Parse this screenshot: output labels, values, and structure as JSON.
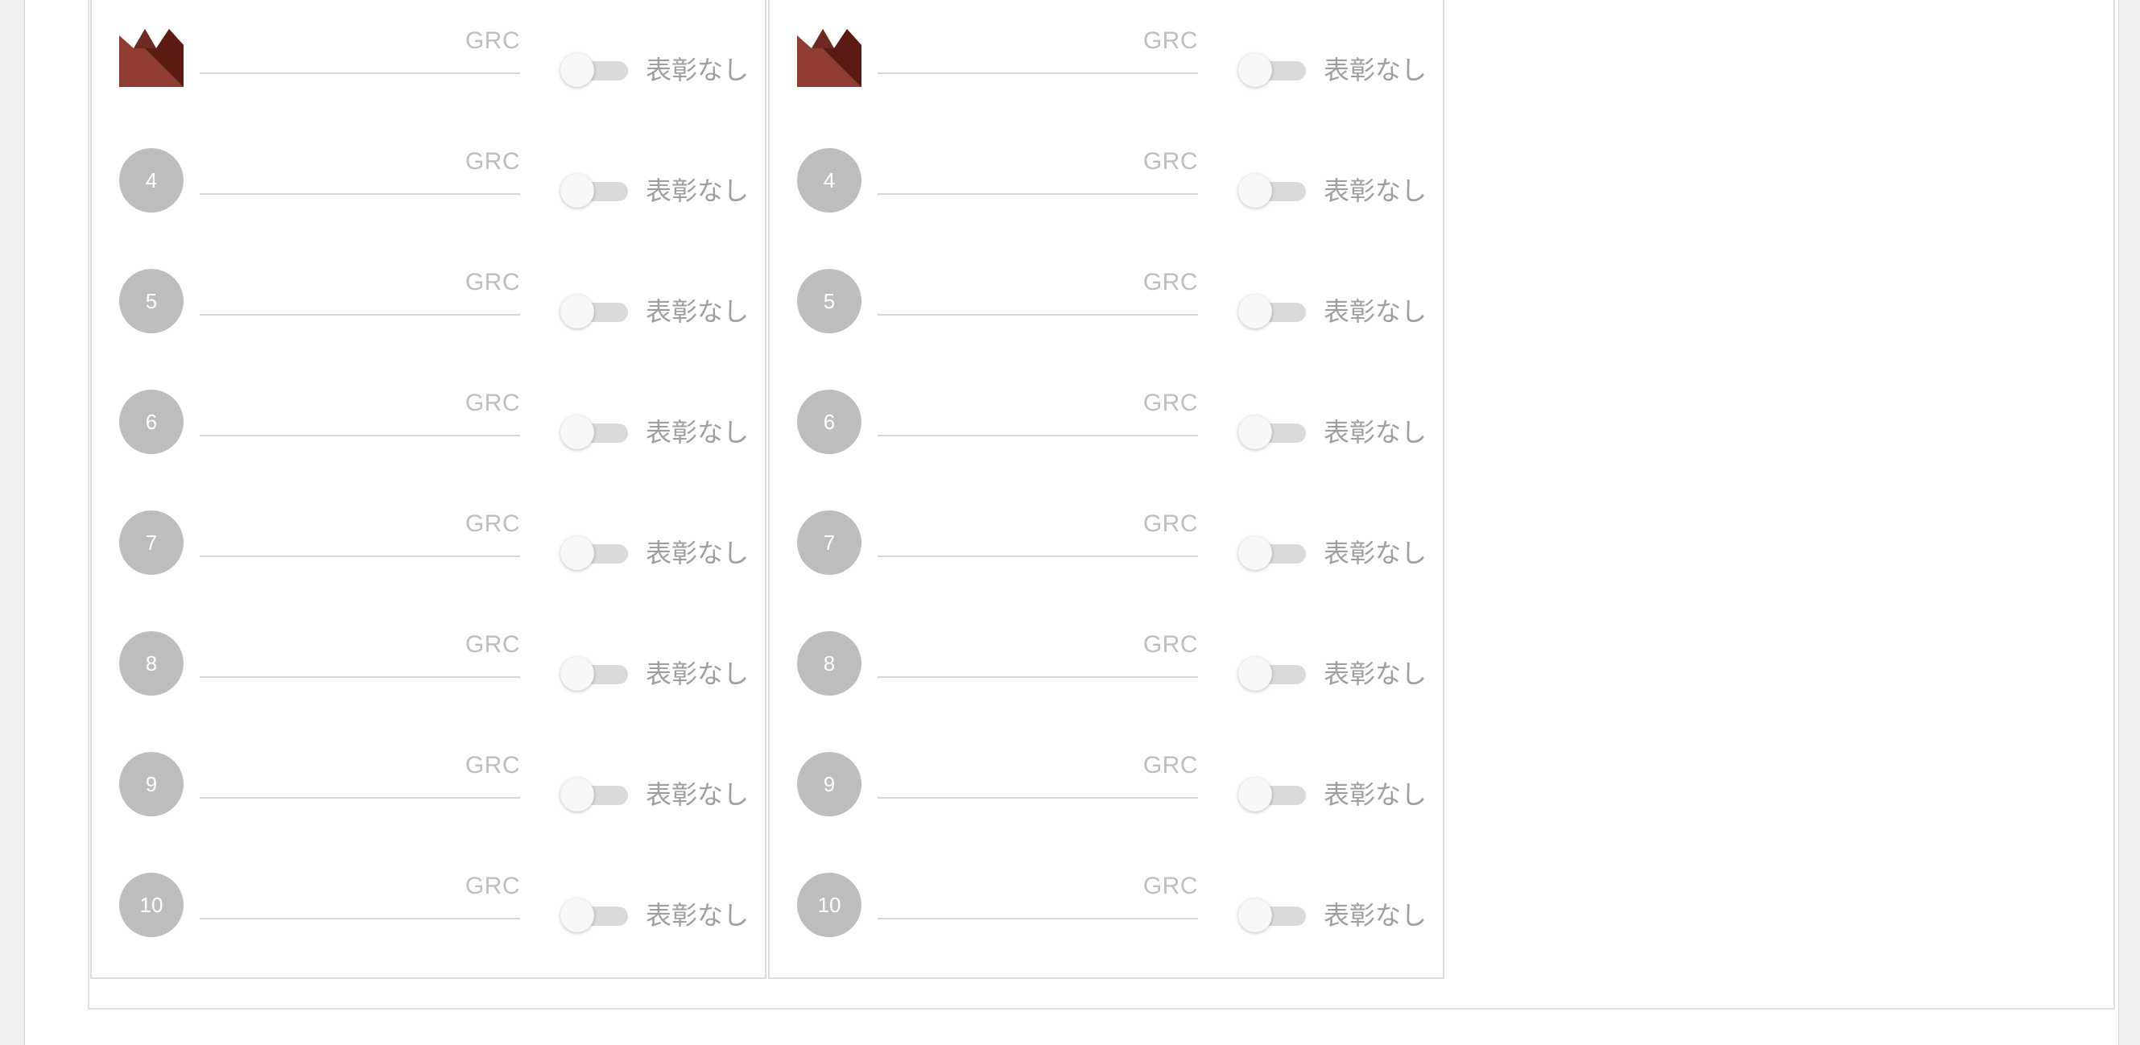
{
  "unit_label": "GRC",
  "award_toggle_label": "表彰なし",
  "colors": {
    "rank_badge": "#bdbdbd",
    "crown_dark": "#5c1a14",
    "crown_light": "#8f3d33"
  },
  "panels": [
    {
      "rows": [
        {
          "rank": "",
          "icon": "crown-icon",
          "value": "",
          "award": false
        },
        {
          "rank": "4",
          "value": "",
          "award": false
        },
        {
          "rank": "5",
          "value": "",
          "award": false
        },
        {
          "rank": "6",
          "value": "",
          "award": false
        },
        {
          "rank": "7",
          "value": "",
          "award": false
        },
        {
          "rank": "8",
          "value": "",
          "award": false
        },
        {
          "rank": "9",
          "value": "",
          "award": false
        },
        {
          "rank": "10",
          "value": "",
          "award": false
        }
      ]
    },
    {
      "rows": [
        {
          "rank": "",
          "icon": "crown-icon",
          "value": "",
          "award": false
        },
        {
          "rank": "4",
          "value": "",
          "award": false
        },
        {
          "rank": "5",
          "value": "",
          "award": false
        },
        {
          "rank": "6",
          "value": "",
          "award": false
        },
        {
          "rank": "7",
          "value": "",
          "award": false
        },
        {
          "rank": "8",
          "value": "",
          "award": false
        },
        {
          "rank": "9",
          "value": "",
          "award": false
        },
        {
          "rank": "10",
          "value": "",
          "award": false
        }
      ]
    }
  ]
}
